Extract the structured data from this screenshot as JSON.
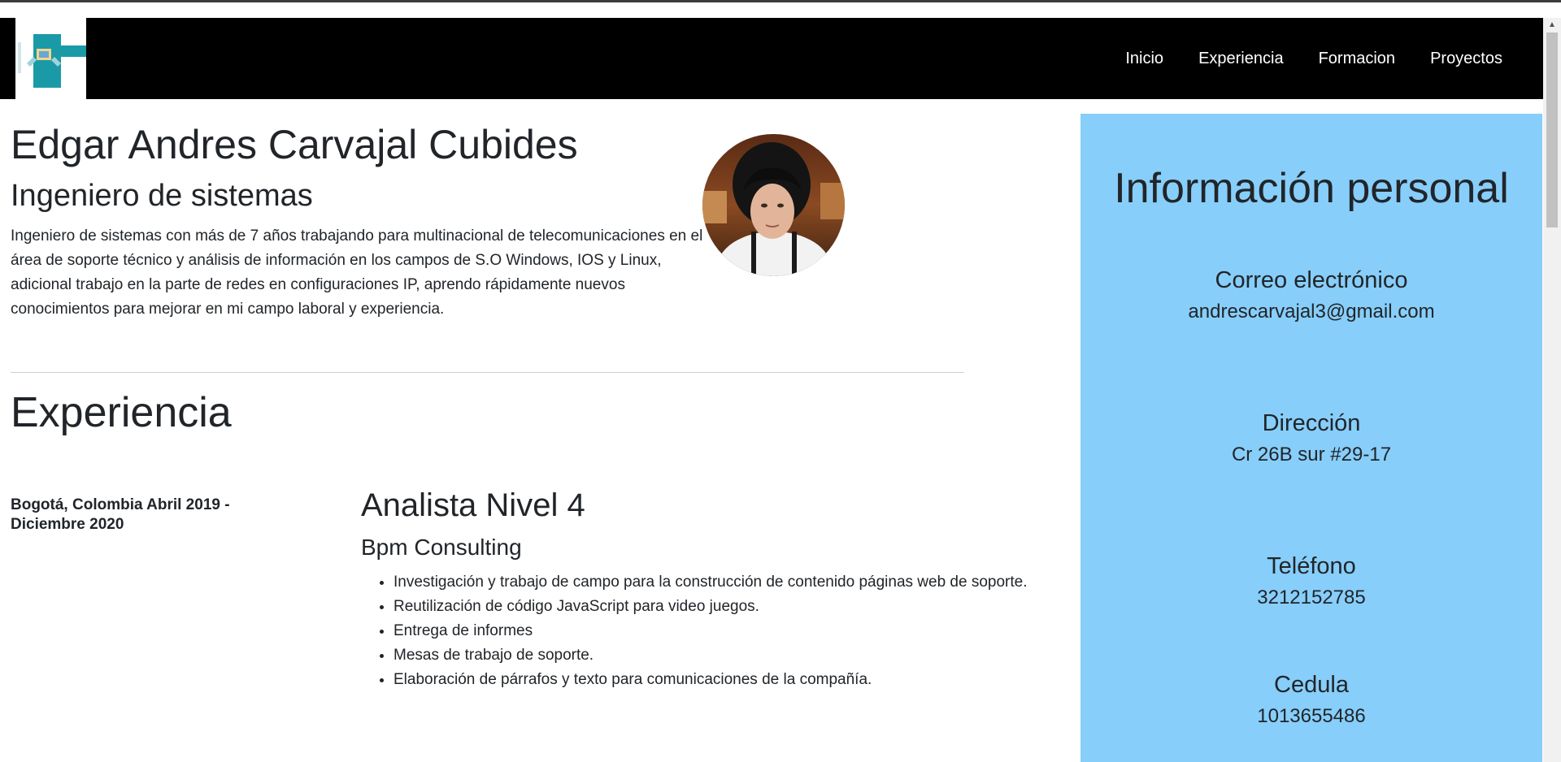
{
  "nav": {
    "logo_alt": "logo",
    "links": [
      "Inicio",
      "Experiencia",
      "Formacion",
      "Proyectos"
    ]
  },
  "profile": {
    "name": "Edgar Andres Carvajal Cubides",
    "role": "Ingeniero de sistemas",
    "summary": "Ingeniero de sistemas con más de 7 años trabajando para multinacional de telecomunicaciones en el área de soporte técnico y análisis de información en los campos de S.O Windows, IOS y Linux, adicional trabajo en la parte de redes en configuraciones IP, aprendo rápidamente nuevos conocimientos para mejorar en mi campo laboral y experiencia."
  },
  "experience": {
    "title": "Experiencia",
    "jobs": [
      {
        "meta": "Bogotá, Colombia Abril 2019 - Diciembre 2020",
        "title": "Analista Nivel 4",
        "company": "Bpm Consulting",
        "tasks": [
          "Investigación y trabajo de campo para la construcción de contenido páginas web de soporte.",
          "Reutilización de código JavaScript para video juegos.",
          "Entrega de informes",
          "Mesas de trabajo de soporte.",
          "Elaboración de párrafos y texto para comunicaciones de la compañía."
        ]
      }
    ]
  },
  "personal_info": {
    "title": "Información personal",
    "items": [
      {
        "label": "Correo electrónico",
        "value": "andrescarvajal3@gmail.com"
      },
      {
        "label": "Dirección",
        "value": "Cr 26B sur #29-17"
      },
      {
        "label": "Teléfono",
        "value": "3212152785"
      },
      {
        "label": "Cedula",
        "value": "1013655486"
      }
    ]
  },
  "colors": {
    "navbar": "#000000",
    "aside_bg": "#87cefa",
    "logo_teal": "#1a9aa6"
  }
}
